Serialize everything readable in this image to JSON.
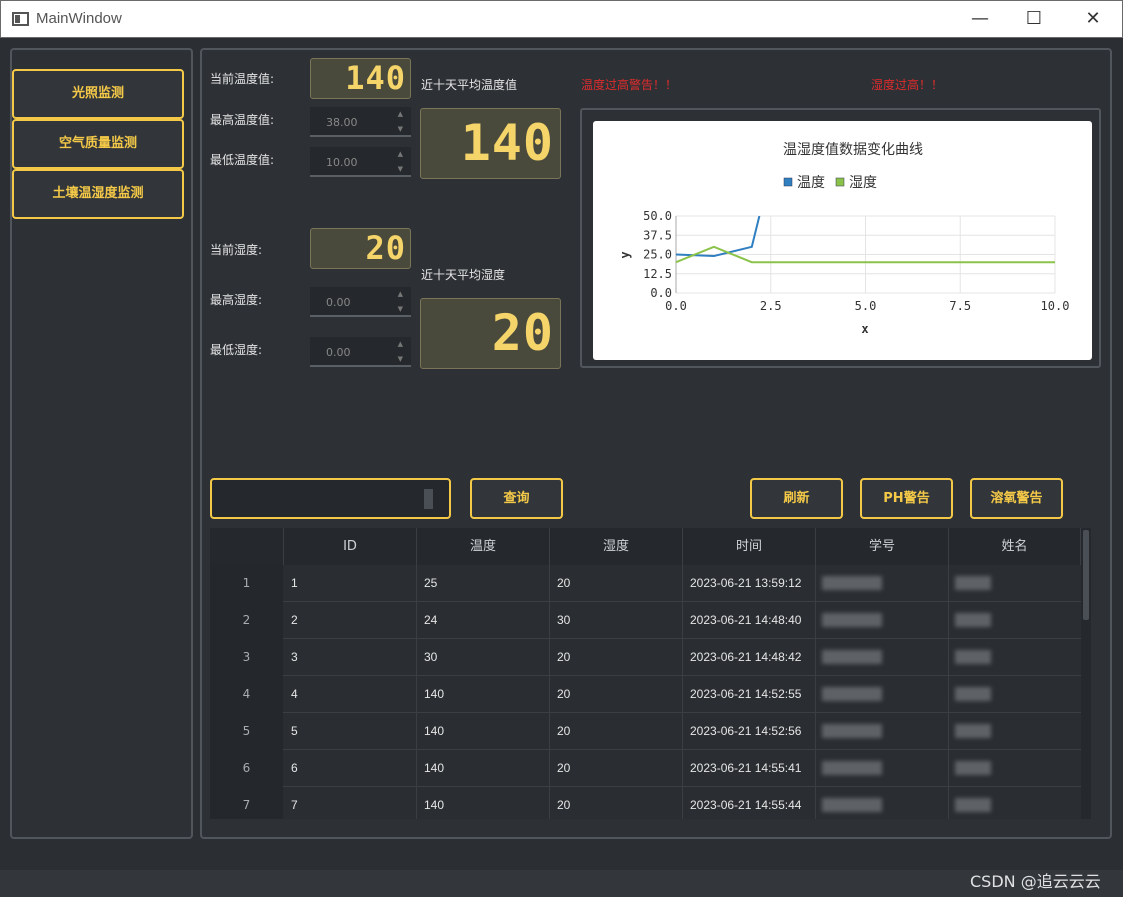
{
  "window": {
    "title": "MainWindow",
    "min": "—",
    "max": "☐",
    "close": "✕"
  },
  "nav": [
    {
      "label": "光照监测"
    },
    {
      "label": "空气质量监测"
    },
    {
      "label": "土壤温湿度监测"
    }
  ],
  "temp": {
    "current_label": "当前温度值:",
    "current_value": "140",
    "max_label": "最高温度值:",
    "max_value": "38.00",
    "min_label": "最低温度值:",
    "min_value": "10.00",
    "avg_label": "近十天平均温度值",
    "avg_value": "140"
  },
  "hum": {
    "current_label": "当前湿度:",
    "current_value": "20",
    "max_label": "最高湿度:",
    "max_value": "0.00",
    "min_label": "最低湿度:",
    "min_value": "0.00",
    "avg_label": "近十天平均湿度",
    "avg_value": "20"
  },
  "warnings": {
    "temp": "温度过高警告！！",
    "hum": "湿度过高！！"
  },
  "buttons": {
    "query": "查询",
    "refresh": "刷新",
    "ph": "PH警告",
    "oxygen": "溶氧警告"
  },
  "search": {
    "value": ""
  },
  "chart_data": {
    "type": "line",
    "title": "温湿度值数据变化曲线",
    "xlabel": "x",
    "ylabel": "y",
    "xlim": [
      0,
      10
    ],
    "ylim": [
      0,
      50
    ],
    "xticks": [
      "0.0",
      "2.5",
      "5.0",
      "7.5",
      "10.0"
    ],
    "yticks": [
      "0.0",
      "12.5",
      "25.0",
      "37.5",
      "50.0"
    ],
    "legend_position": "top",
    "series": [
      {
        "name": "温度",
        "color": "#2f7fc1",
        "x": [
          0,
          1,
          2,
          2.2
        ],
        "y": [
          25,
          24,
          30,
          50
        ]
      },
      {
        "name": "湿度",
        "color": "#8bc34a",
        "x": [
          0,
          1,
          2,
          3,
          4,
          5,
          6,
          7,
          8,
          9,
          10
        ],
        "y": [
          20,
          30,
          20,
          20,
          20,
          20,
          20,
          20,
          20,
          20,
          20
        ]
      }
    ]
  },
  "table": {
    "headers": [
      "ID",
      "温度",
      "湿度",
      "时间",
      "学号",
      "姓名"
    ],
    "rows": [
      {
        "num": "1",
        "id": "1",
        "temp": "25",
        "hum": "20",
        "time": "2023-06-21 13:59:12"
      },
      {
        "num": "2",
        "id": "2",
        "temp": "24",
        "hum": "30",
        "time": "2023-06-21 14:48:40"
      },
      {
        "num": "3",
        "id": "3",
        "temp": "30",
        "hum": "20",
        "time": "2023-06-21 14:48:42"
      },
      {
        "num": "4",
        "id": "4",
        "temp": "140",
        "hum": "20",
        "time": "2023-06-21 14:52:55"
      },
      {
        "num": "5",
        "id": "5",
        "temp": "140",
        "hum": "20",
        "time": "2023-06-21 14:52:56"
      },
      {
        "num": "6",
        "id": "6",
        "temp": "140",
        "hum": "20",
        "time": "2023-06-21 14:55:41"
      },
      {
        "num": "7",
        "id": "7",
        "temp": "140",
        "hum": "20",
        "time": "2023-06-21 14:55:44"
      }
    ]
  },
  "watermark": "CSDN @追云云云"
}
